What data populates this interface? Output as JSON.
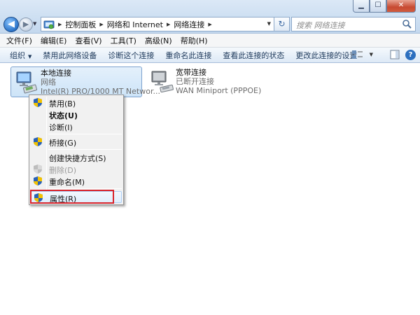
{
  "window": {
    "minimize_glyph": "▁",
    "maximize_glyph": "☐",
    "close_glyph": "✕"
  },
  "nav": {
    "back_glyph": "◀",
    "forward_glyph": "▶",
    "history_glyph": "▼"
  },
  "address": {
    "breadcrumbs": [
      "控制面板",
      "网络和 Internet",
      "网络连接"
    ],
    "separator_glyph": "▶",
    "dropdown_glyph": "▼",
    "refresh_glyph": "↻"
  },
  "search": {
    "placeholder": "搜索 网络连接"
  },
  "menubar": [
    "文件(F)",
    "编辑(E)",
    "查看(V)",
    "工具(T)",
    "高级(N)",
    "帮助(H)"
  ],
  "commands": {
    "organize": "组织",
    "disable": "禁用此网络设备",
    "diagnose": "诊断这个连接",
    "rename": "重命名此连接",
    "status": "查看此连接的状态",
    "settings": "更改此连接的设置",
    "dropdown_glyph": "▼",
    "help_glyph": "?"
  },
  "connections": [
    {
      "name": "本地连接",
      "status": "网络",
      "device": "Intel(R) PRO/1000 MT Networ..."
    },
    {
      "name": "宽带连接",
      "status": "已断开连接",
      "device": "WAN Miniport (PPPOE)"
    }
  ],
  "context_menu": {
    "disable": "禁用(B)",
    "status": "状态(U)",
    "diagnose": "诊断(I)",
    "bridge": "桥接(G)",
    "shortcut": "创建快捷方式(S)",
    "delete": "删除(D)",
    "rename": "重命名(M)",
    "properties": "属性(R)"
  },
  "colors": {
    "highlight_box": "#d9232b",
    "selection": "#cde4f8",
    "accent": "#2c6fbf"
  }
}
